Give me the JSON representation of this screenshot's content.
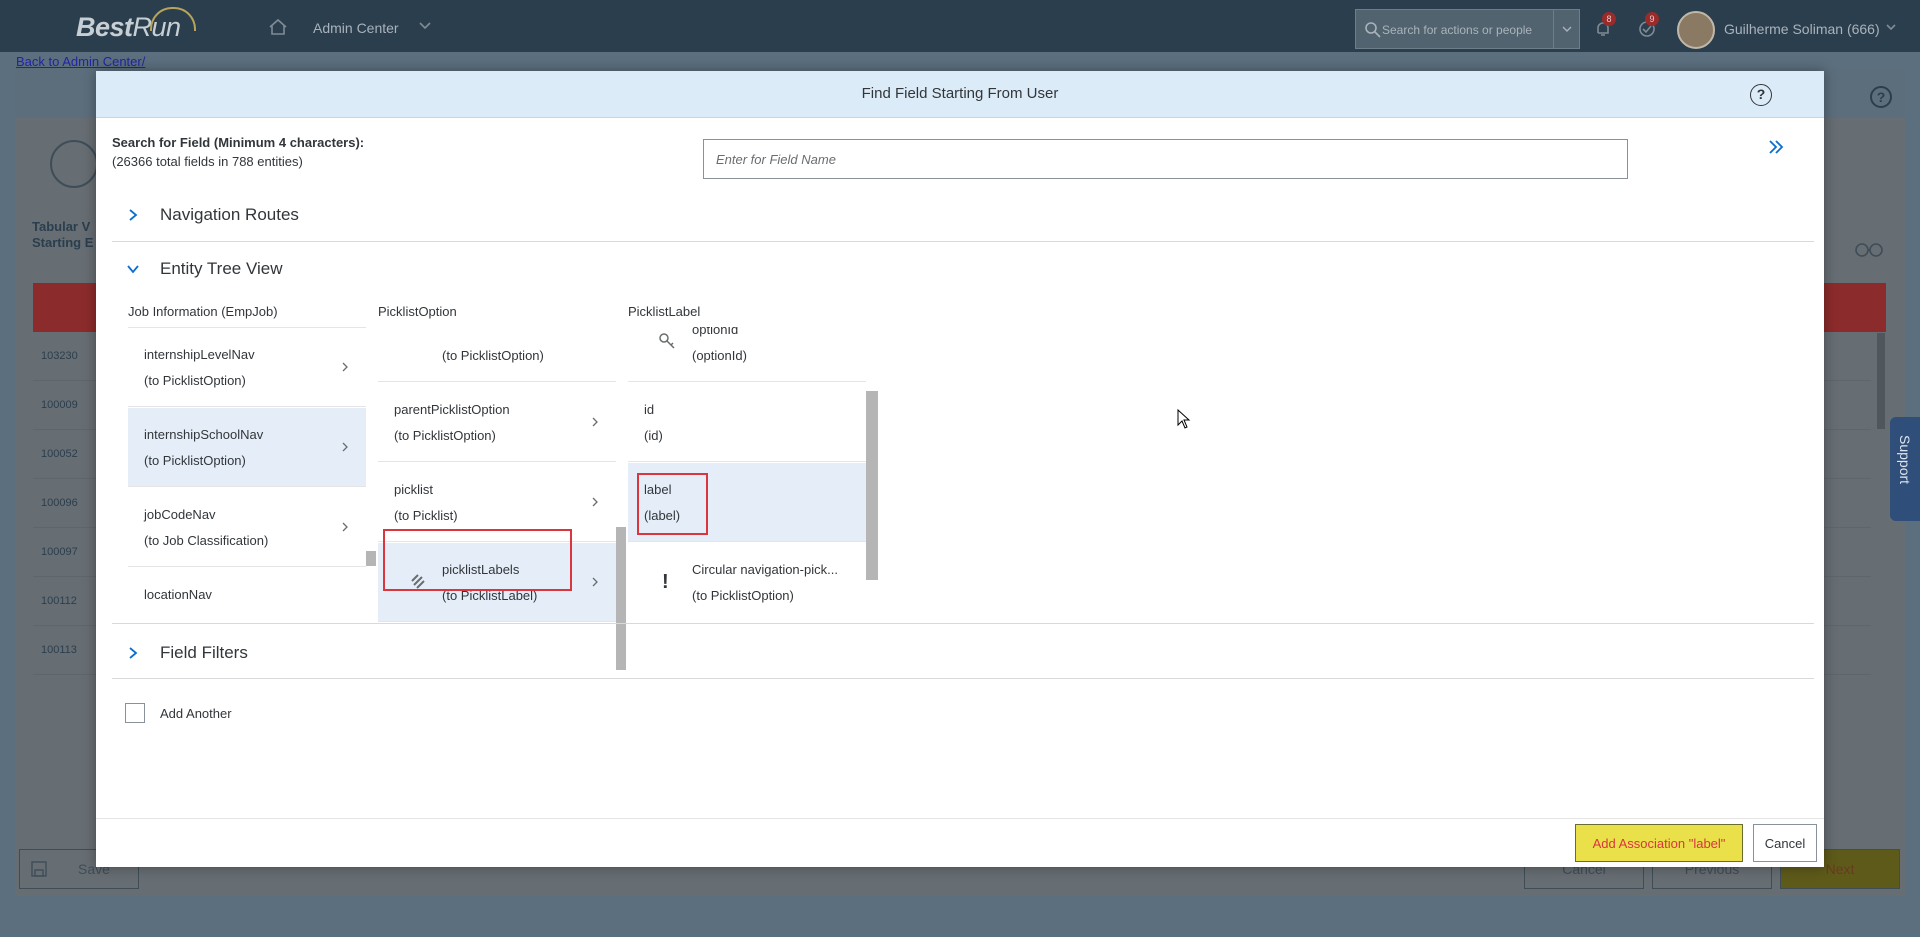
{
  "shell": {
    "logo_best": "Best",
    "logo_run": "Run",
    "title": "Admin Center",
    "search_placeholder": "Search for actions or people",
    "notifications_count": "8",
    "todo_count": "9",
    "user_name": "Guilherme Soliman (666)"
  },
  "background": {
    "back_link": "Back to Admin Center/",
    "tab_title_line1": "Tabular V",
    "tab_title_line2": "Starting E",
    "rows": [
      "103230",
      "100009",
      "100052",
      "100096",
      "100097",
      "100112",
      "100113"
    ],
    "save_label": "Save",
    "cancel_label": "Cancel",
    "previous_label": "Previous",
    "next_label": "Next",
    "support_label": "Support"
  },
  "dialog": {
    "title": "Find Field Starting From User",
    "search_label": "Search for Field (Minimum 4 characters):",
    "search_count": "(26366 total fields in 788 entities)",
    "search_placeholder": "Enter for Field Name",
    "sections": {
      "navigation_routes": "Navigation Routes",
      "entity_tree_view": "Entity Tree View",
      "field_filters": "Field Filters"
    },
    "columns": [
      {
        "header": "Job Information (EmpJob)",
        "items": [
          {
            "name": "internshipLevelNav",
            "target": "(to PicklistOption)"
          },
          {
            "name": "internshipSchoolNav",
            "target": "(to PicklistOption)"
          },
          {
            "name": "jobCodeNav",
            "target": "(to Job Classification)"
          },
          {
            "name": "locationNav",
            "target": ""
          }
        ]
      },
      {
        "header": "PicklistOption",
        "items": [
          {
            "name": "",
            "target": "(to PicklistOption)"
          },
          {
            "name": "parentPicklistOption",
            "target": "(to PicklistOption)"
          },
          {
            "name": "picklist",
            "target": "(to Picklist)"
          },
          {
            "name": "picklistLabels",
            "target": "(to PicklistLabel)"
          }
        ]
      },
      {
        "header": "PicklistLabel",
        "items": [
          {
            "name": "optionId",
            "target": "(optionId)"
          },
          {
            "name": "id",
            "target": "(id)"
          },
          {
            "name": "label",
            "target": "(label)"
          },
          {
            "name": "Circular navigation-pick...",
            "target": "(to PicklistOption)"
          }
        ]
      }
    ],
    "add_another_label": "Add Another",
    "add_button_label": "Add Association \"label\"",
    "cancel_button_label": "Cancel"
  },
  "colors": {
    "dialog_header": "#dcebf8",
    "selection": "#e5eef8",
    "highlight_border": "#d9363e",
    "add_button": "#e9e04a"
  }
}
